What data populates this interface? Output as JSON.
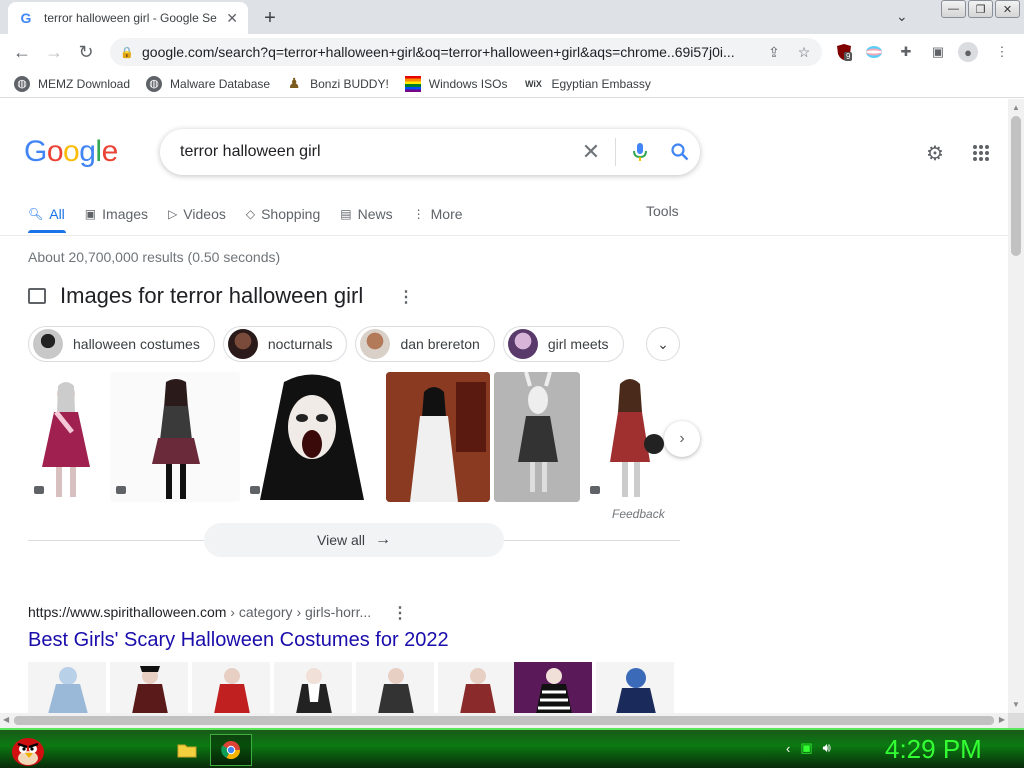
{
  "browser": {
    "tab_title": "terror halloween girl - Google Se",
    "tab_favicon": "G",
    "url": "google.com/search?q=terror+halloween+girl&oq=terror+halloween+girl&aqs=chrome..69i57j0i...",
    "ext_badge": "9"
  },
  "bookmarks": [
    {
      "label": "MEMZ Download",
      "icon": "globe-icon"
    },
    {
      "label": "Malware Database",
      "icon": "globe-icon"
    },
    {
      "label": "Bonzi BUDDY!",
      "icon": "bonzi-icon"
    },
    {
      "label": "Windows ISOs",
      "icon": "windows-flag-icon"
    },
    {
      "label": "Egyptian Embassy",
      "icon": "wix-icon"
    }
  ],
  "google": {
    "logo": [
      "G",
      "o",
      "o",
      "g",
      "l",
      "e"
    ],
    "query": "terror halloween girl",
    "tabs": [
      {
        "label": "All",
        "icon": "search-icon"
      },
      {
        "label": "Images",
        "icon": "image-icon"
      },
      {
        "label": "Videos",
        "icon": "video-icon"
      },
      {
        "label": "Shopping",
        "icon": "tag-icon"
      },
      {
        "label": "News",
        "icon": "news-icon"
      },
      {
        "label": "More",
        "icon": "more-vert-icon"
      }
    ],
    "tools": "Tools",
    "stats": "About 20,700,000 results (0.50 seconds)",
    "images_title": "Images for terror halloween girl",
    "chips": [
      "halloween costumes",
      "nocturnals",
      "dan brereton",
      "girl meets"
    ],
    "feedback": "Feedback",
    "view_all": "View all",
    "result": {
      "cite_domain": "https://www.spirithalloween.com",
      "cite_path": " › category › girls-horr...",
      "title": "Best Girls' Scary Halloween Costumes for 2022"
    }
  },
  "taskbar": {
    "clock": "4:29 PM"
  },
  "colors": {
    "link": "#1a0dab",
    "accent": "#1a73e8",
    "taskbar_green": "#0b7a12",
    "clock_green": "#33ff33"
  }
}
